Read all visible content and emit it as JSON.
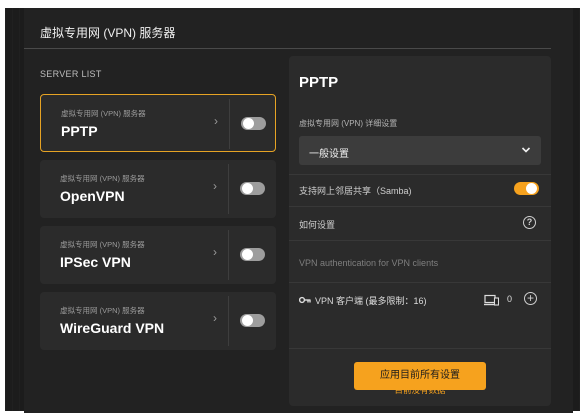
{
  "header": {
    "title": "虚拟专用网 (VPN) 服务器"
  },
  "server_list": {
    "label": "SERVER LIST",
    "items": [
      {
        "subtitle": "虚拟专用网 (VPN) 服务器",
        "name": "PPTP",
        "active": true,
        "enabled": false
      },
      {
        "subtitle": "虚拟专用网 (VPN) 服务器",
        "name": "OpenVPN",
        "active": false,
        "enabled": false
      },
      {
        "subtitle": "虚拟专用网 (VPN) 服务器",
        "name": "IPSec VPN",
        "active": false,
        "enabled": false
      },
      {
        "subtitle": "虚拟专用网 (VPN) 服务器",
        "name": "WireGuard VPN",
        "active": false,
        "enabled": false
      }
    ]
  },
  "detail": {
    "title": "PPTP",
    "settings_label": "虚拟专用网 (VPN) 详细设置",
    "settings_select": {
      "value": "一般设置"
    },
    "samba": {
      "label": "支持网上邻居共享（Samba)",
      "enabled": true
    },
    "howto": {
      "label": "如何设置"
    },
    "auth_label": "VPN authentication for VPN clients",
    "clients": {
      "label": "VPN 客户端 (最多限制：16)",
      "count": "0"
    },
    "no_data": "目前没有数据",
    "apply_button": "应用目前所有设置"
  },
  "colors": {
    "accent": "#f6a21e",
    "background": "#1c1c1c",
    "card": "#2b2b2b"
  }
}
